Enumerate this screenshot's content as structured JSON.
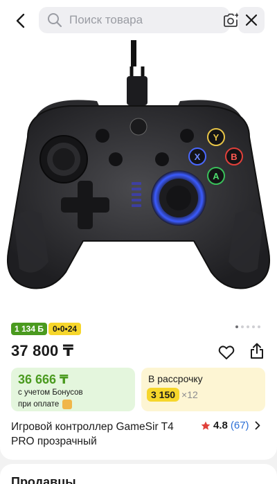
{
  "search": {
    "placeholder": "Поиск товара"
  },
  "product": {
    "bonus_badge": "1 134 Б",
    "installment_badge": "0•0•24",
    "price": "37 800 ₸",
    "bonus_card": {
      "amount": "36 666 ₸",
      "line1": "с учетом Бонусов",
      "line2": "при оплате"
    },
    "installment_card": {
      "title": "В рассрочку",
      "monthly": "3 150",
      "multiplier": "×12"
    },
    "title": "Игровой контроллер GameSir T4 PRO прозрачный",
    "rating": "4.8",
    "reviews": "(67)",
    "gallery": {
      "total_images": 5,
      "current_image": 1
    }
  },
  "sellers": {
    "heading": "Продавцы"
  },
  "colors": {
    "bonus_green": "#4a9a1f",
    "installment_yellow": "#f6d62b",
    "link_blue": "#2b6fd6",
    "star_red": "#e0403a"
  },
  "icons": [
    "back-arrow-icon",
    "search-icon",
    "camera-sparkle-icon",
    "close-icon",
    "heart-icon",
    "share-icon",
    "star-icon",
    "chevron-right-icon"
  ]
}
